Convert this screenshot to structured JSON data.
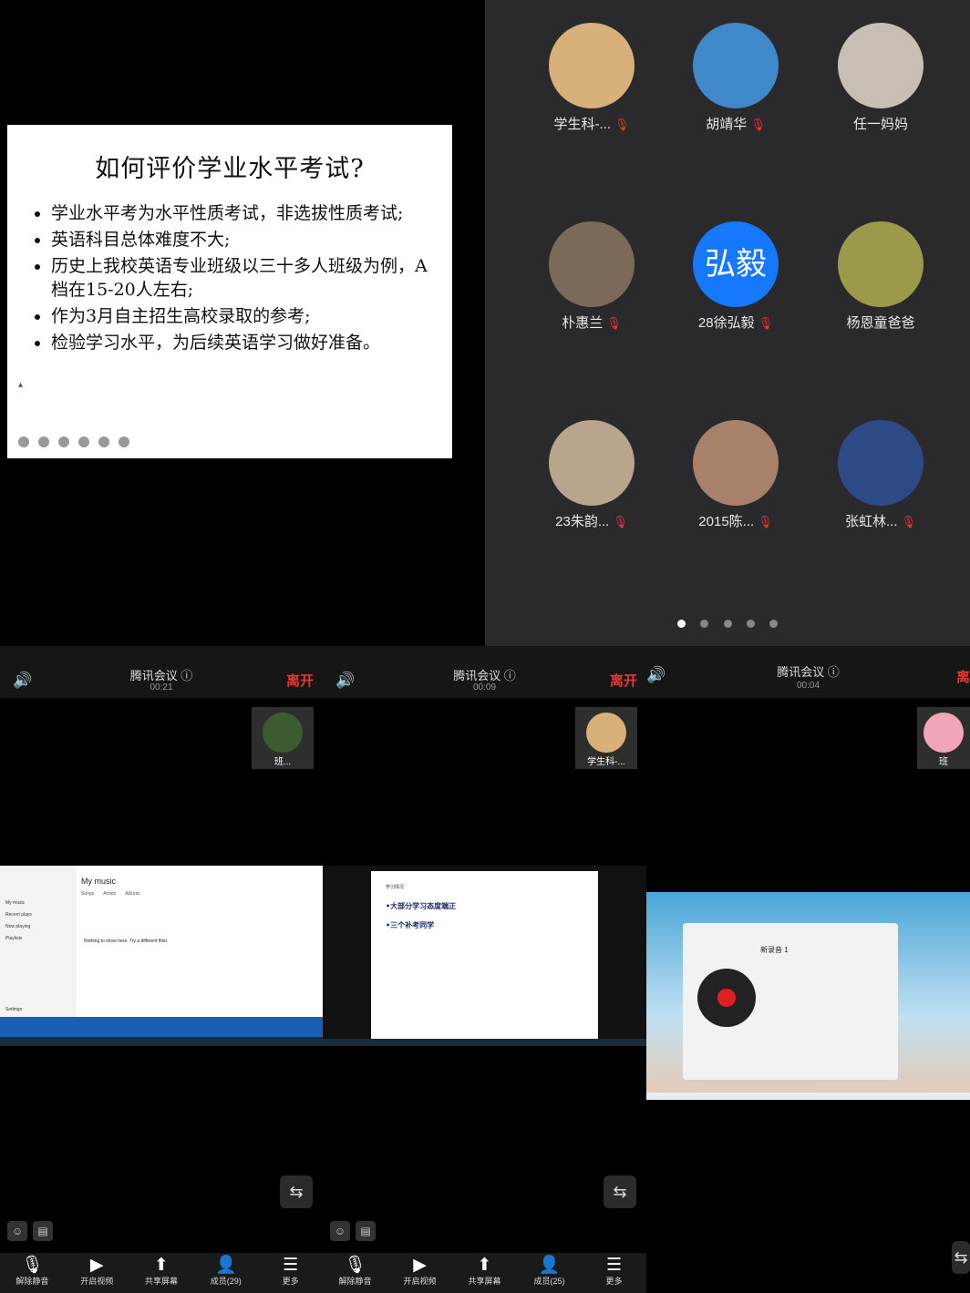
{
  "slide": {
    "title": "如何评价学业水平考试?",
    "bullets": [
      "学业水平考为水平性质考试，非选拔性质考试;",
      "英语科目总体难度不大;",
      "历史上我校英语专业班级以三十多人班级为例，A档在15-20人左右;",
      "作为3月自主招生高校录取的参考;",
      "检验学习水平，为后续英语学习做好准备。"
    ]
  },
  "participants": [
    {
      "name": "学生科-...",
      "muted": true,
      "avatar_label": "",
      "avatar_color": "#d8b07a"
    },
    {
      "name": "胡靖华",
      "muted": true,
      "avatar_label": "",
      "avatar_color": "#3f88c9"
    },
    {
      "name": "任一妈妈",
      "muted": false,
      "avatar_label": "",
      "avatar_color": "#c8bfb4"
    },
    {
      "name": "朴惠兰",
      "muted": true,
      "avatar_label": "",
      "avatar_color": "#7b6a58"
    },
    {
      "name": "28徐弘毅",
      "muted": true,
      "avatar_label": "弘毅",
      "avatar_color": "#1677ff"
    },
    {
      "name": "杨恩童爸爸",
      "muted": false,
      "avatar_label": "",
      "avatar_color": "#9a9a4a"
    },
    {
      "name": "23朱韵...",
      "muted": true,
      "avatar_label": "",
      "avatar_color": "#b9a48e"
    },
    {
      "name": "2015陈...",
      "muted": true,
      "avatar_label": "",
      "avatar_color": "#a8816a"
    },
    {
      "name": "张虹林...",
      "muted": true,
      "avatar_label": "",
      "avatar_color": "#2d4a86"
    }
  ],
  "page_dots": {
    "count": 5,
    "active": 0
  },
  "panels": [
    {
      "meeting_title": "腾讯会议 ⓘ",
      "time": "00:21",
      "leave": "离开",
      "pip_name": "班...",
      "share": {
        "app_title": "My music",
        "tabs": [
          "Songs",
          "Artists",
          "Albums"
        ],
        "empty": "Nothing to show here. Try a different filter.",
        "sidebar": [
          "My music",
          "Recent plays",
          "Now playing",
          "Playlists",
          "Settings"
        ]
      },
      "toolbar": [
        {
          "icon": "mic-off-icon",
          "label": "解除静音"
        },
        {
          "icon": "video-off-icon",
          "label": "开启视频"
        },
        {
          "icon": "share-screen-icon",
          "label": "共享屏幕"
        },
        {
          "icon": "members-icon",
          "label": "成员(29)"
        },
        {
          "icon": "more-icon",
          "label": "更多"
        }
      ]
    },
    {
      "meeting_title": "腾讯会议 ⓘ",
      "time": "00:09",
      "leave": "离开",
      "pip_name": "学生科-...",
      "share": {
        "heading": "学习情况",
        "lines": [
          "•大部分学习态度端正",
          "•三个补考同学"
        ]
      },
      "toolbar": [
        {
          "icon": "mic-off-icon",
          "label": "解除静音"
        },
        {
          "icon": "video-off-icon",
          "label": "开启视频"
        },
        {
          "icon": "share-screen-icon",
          "label": "共享屏幕"
        },
        {
          "icon": "members-icon",
          "label": "成员(25)"
        },
        {
          "icon": "more-icon",
          "label": "更多"
        }
      ]
    },
    {
      "meeting_title": "腾讯会议 ⓘ",
      "time": "00:04",
      "leave": "离",
      "pip_name": "班",
      "share": {
        "recording_title": "新录音 1"
      }
    }
  ]
}
